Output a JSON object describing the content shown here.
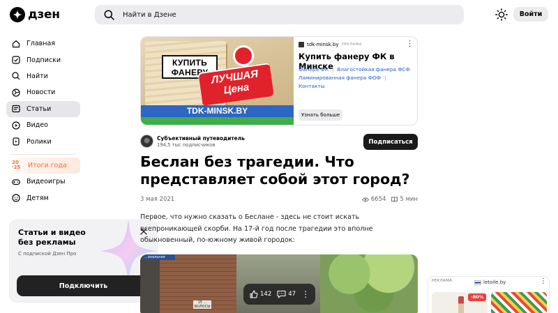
{
  "header": {
    "logo_text": "дзен",
    "search_placeholder": "Найти в Дзене",
    "login_label": "Войти"
  },
  "sidebar": {
    "items": [
      {
        "label": "Главная",
        "icon": "home-icon"
      },
      {
        "label": "Подписки",
        "icon": "subscriptions-icon"
      },
      {
        "label": "Найти",
        "icon": "search-icon"
      },
      {
        "label": "Новости",
        "icon": "news-icon"
      },
      {
        "label": "Статьи",
        "icon": "articles-icon",
        "active": true
      },
      {
        "label": "Видео",
        "icon": "video-icon"
      },
      {
        "label": "Ролики",
        "icon": "shorts-icon"
      }
    ],
    "year_item": {
      "label": "Итоги года",
      "badge_top": "20",
      "badge_bottom": "25"
    },
    "items2": [
      {
        "label": "Видеоигры",
        "icon": "gamepad-icon"
      },
      {
        "label": "Детям",
        "icon": "kids-icon"
      }
    ]
  },
  "promo": {
    "title": "Статьи и видео без рекламы",
    "subtitle": "С подпиской Дзен Про",
    "button_label": "Подключить"
  },
  "ad": {
    "image_text_buy": "КУПИТЬ ФАНЕРУ",
    "image_text_best": "ЛУЧШАЯ Цена",
    "image_site": "TDK-MINSK.BY",
    "source": "tdk-minsk.by",
    "label": "РЕКЛАМА",
    "title": "Купить фанеру ФК в Минске",
    "links": [
      "Фанера ФК",
      "Влагостойкая фанера ФСФ",
      "Ламинированная фанера ФОФ",
      "Контакты"
    ],
    "cta": "Узнать больше"
  },
  "article": {
    "channel_name": "Субъективный путеводитель",
    "channel_subs": "194,5 тыс подписчиков",
    "subscribe_label": "Подписаться",
    "title": "Беслан без трагедии. Что представляет собой этот город?",
    "date": "3 мая 2021",
    "views": "6654",
    "read_time": "5 мин",
    "text": "Первое, что нужно сказать о Беслане - здесь не стоит искать всепроникающей скорби. На 17-й год после трагедии это вполне обыкновенный, по-южному живой городок:",
    "photo_sign": "...ональная",
    "photo_plate": "15 ... ВОЛОСЫ",
    "likes": "142",
    "comments": "47"
  },
  "side_ad": {
    "label": "РЕКЛАМА",
    "site": "letoile.by",
    "discount": "-80%"
  }
}
